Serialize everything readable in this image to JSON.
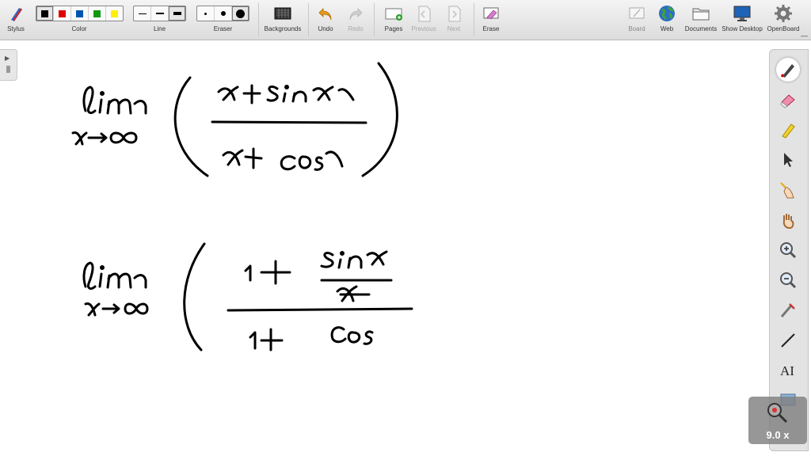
{
  "toolbar": {
    "stylus": "Stylus",
    "color": "Color",
    "line": "Line",
    "eraser": "Eraser",
    "backgrounds": "Backgrounds",
    "undo": "Undo",
    "redo": "Redo",
    "pages": "Pages",
    "previous": "Previous",
    "next": "Next",
    "erase": "Erase",
    "board": "Board",
    "web": "Web",
    "documents": "Documents",
    "show_desktop": "Show Desktop",
    "openboard": "OpenBoard"
  },
  "colors": [
    "#000000",
    "#e00000",
    "#0055b0",
    "#119911",
    "#ffee00"
  ],
  "zoom": {
    "level": "9.0 x"
  },
  "right_tools": [
    "pen-icon",
    "eraser-icon",
    "highlighter-icon",
    "arrow-pointer-icon",
    "laser-pointer-icon",
    "hand-icon",
    "zoom-in-icon",
    "zoom-out-icon",
    "capture-icon",
    "line-icon",
    "text-icon",
    "shape-icon"
  ]
}
